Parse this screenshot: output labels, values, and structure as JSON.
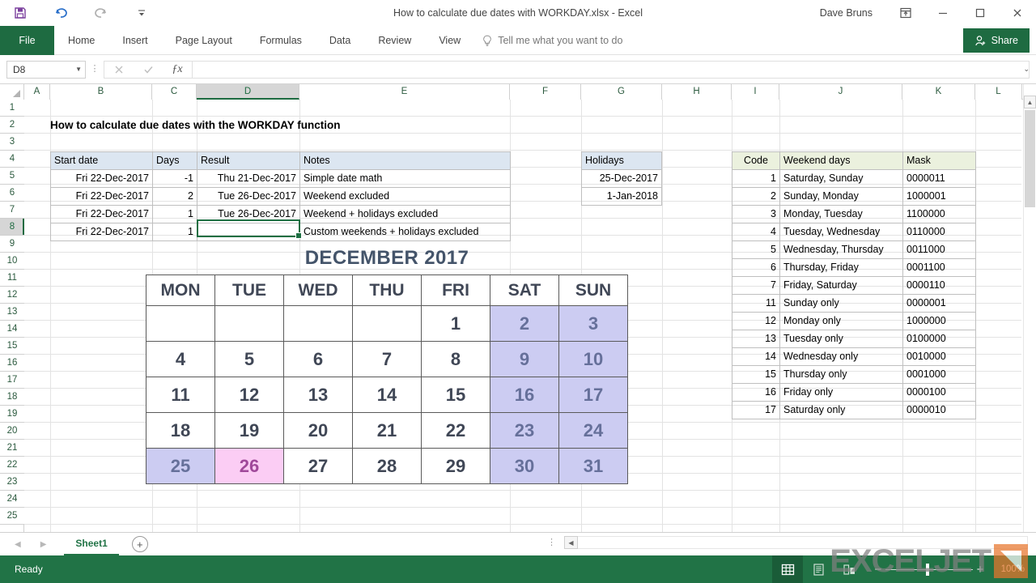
{
  "titlebar": {
    "save_icon": "save-icon",
    "undo_icon": "undo-icon",
    "redo_icon": "redo-icon",
    "customize_icon": "customize-qat-icon",
    "document_title": "How to calculate due dates with WORKDAY.xlsx - Excel",
    "username": "Dave Bruns",
    "ribbon_display_icon": "ribbon-display-options-icon",
    "minimize": "—",
    "maximize": "☐",
    "close": "✕"
  },
  "ribbon": {
    "file_tab": "File",
    "tabs": [
      "Home",
      "Insert",
      "Page Layout",
      "Formulas",
      "Data",
      "Review",
      "View"
    ],
    "tell_me": "Tell me what you want to do",
    "share": "Share"
  },
  "formula_bar": {
    "name_box": "D8",
    "cancel_icon": "cancel-icon",
    "enter_icon": "confirm-icon",
    "function_icon": "insert-function-icon",
    "formula_value": "",
    "expand_icon": "expand-formula-bar-icon"
  },
  "grid": {
    "columns": [
      "A",
      "B",
      "C",
      "D",
      "E",
      "F",
      "G",
      "H",
      "I",
      "J",
      "K",
      "L"
    ],
    "selected_column": "D",
    "rows": [
      1,
      2,
      3,
      4,
      5,
      6,
      7,
      8,
      9,
      10,
      11,
      12,
      13,
      14,
      15,
      16,
      17,
      18,
      19,
      20,
      21,
      22,
      23,
      24,
      25
    ],
    "selected_row": 8,
    "selected_cell": "D8"
  },
  "sheet": {
    "title": "How to calculate due dates with the WORKDAY function",
    "main_table": {
      "headers": [
        "Start date",
        "Days",
        "Result",
        "Notes"
      ],
      "rows": [
        {
          "start_date": "Fri 22-Dec-2017",
          "days": "-1",
          "result": "Thu 21-Dec-2017",
          "notes": "Simple date math"
        },
        {
          "start_date": "Fri 22-Dec-2017",
          "days": "2",
          "result": "Tue 26-Dec-2017",
          "notes": "Weekend excluded"
        },
        {
          "start_date": "Fri 22-Dec-2017",
          "days": "1",
          "result": "Tue 26-Dec-2017",
          "notes": "Weekend + holidays excluded"
        },
        {
          "start_date": "Fri 22-Dec-2017",
          "days": "1",
          "result": "",
          "notes": "Custom weekends + holidays excluded"
        }
      ]
    },
    "holidays_table": {
      "header": "Holidays",
      "rows": [
        "25-Dec-2017",
        "1-Jan-2018"
      ]
    },
    "weekend_codes_table": {
      "headers": [
        "Code",
        "Weekend days",
        "Mask"
      ],
      "rows": [
        {
          "code": "1",
          "days": "Saturday, Sunday",
          "mask": "0000011"
        },
        {
          "code": "2",
          "days": "Sunday, Monday",
          "mask": "1000001"
        },
        {
          "code": "3",
          "days": "Monday, Tuesday",
          "mask": "1100000"
        },
        {
          "code": "4",
          "days": "Tuesday, Wednesday",
          "mask": "0110000"
        },
        {
          "code": "5",
          "days": "Wednesday, Thursday",
          "mask": "0011000"
        },
        {
          "code": "6",
          "days": "Thursday, Friday",
          "mask": "0001100"
        },
        {
          "code": "7",
          "days": "Friday, Saturday",
          "mask": "0000110"
        },
        {
          "code": "11",
          "days": "Sunday only",
          "mask": "0000001"
        },
        {
          "code": "12",
          "days": "Monday only",
          "mask": "1000000"
        },
        {
          "code": "13",
          "days": "Tuesday only",
          "mask": "0100000"
        },
        {
          "code": "14",
          "days": "Wednesday only",
          "mask": "0010000"
        },
        {
          "code": "15",
          "days": "Thursday only",
          "mask": "0001000"
        },
        {
          "code": "16",
          "days": "Friday only",
          "mask": "0000100"
        },
        {
          "code": "17",
          "days": "Saturday only",
          "mask": "0000010"
        }
      ]
    },
    "calendar": {
      "title": "DECEMBER 2017",
      "day_headers": [
        "MON",
        "TUE",
        "WED",
        "THU",
        "FRI",
        "SAT",
        "SUN"
      ],
      "weeks": [
        [
          {
            "d": "",
            "t": "empty"
          },
          {
            "d": "",
            "t": "empty"
          },
          {
            "d": "",
            "t": "empty"
          },
          {
            "d": "",
            "t": "empty"
          },
          {
            "d": "1",
            "t": "day"
          },
          {
            "d": "2",
            "t": "weekend"
          },
          {
            "d": "3",
            "t": "weekend"
          }
        ],
        [
          {
            "d": "4",
            "t": "day"
          },
          {
            "d": "5",
            "t": "day"
          },
          {
            "d": "6",
            "t": "day"
          },
          {
            "d": "7",
            "t": "day"
          },
          {
            "d": "8",
            "t": "day"
          },
          {
            "d": "9",
            "t": "weekend"
          },
          {
            "d": "10",
            "t": "weekend"
          }
        ],
        [
          {
            "d": "11",
            "t": "day"
          },
          {
            "d": "12",
            "t": "day"
          },
          {
            "d": "13",
            "t": "day"
          },
          {
            "d": "14",
            "t": "day"
          },
          {
            "d": "15",
            "t": "day"
          },
          {
            "d": "16",
            "t": "weekend"
          },
          {
            "d": "17",
            "t": "weekend"
          }
        ],
        [
          {
            "d": "18",
            "t": "day"
          },
          {
            "d": "19",
            "t": "day"
          },
          {
            "d": "20",
            "t": "day"
          },
          {
            "d": "21",
            "t": "day"
          },
          {
            "d": "22",
            "t": "day"
          },
          {
            "d": "23",
            "t": "weekend"
          },
          {
            "d": "24",
            "t": "weekend"
          }
        ],
        [
          {
            "d": "25",
            "t": "weekend"
          },
          {
            "d": "26",
            "t": "highlight"
          },
          {
            "d": "27",
            "t": "day"
          },
          {
            "d": "28",
            "t": "day"
          },
          {
            "d": "29",
            "t": "day"
          },
          {
            "d": "30",
            "t": "weekend"
          },
          {
            "d": "31",
            "t": "weekend"
          }
        ]
      ],
      "colors": {
        "weekend_bg": "#ccccf2",
        "weekend_fg": "#66709a",
        "highlight_bg": "#fbcdf4",
        "highlight_fg": "#a0499a",
        "title_fg": "#44546a"
      }
    }
  },
  "sheet_tabs": {
    "prev_icon": "prev-sheet-icon",
    "next_icon": "next-sheet-icon",
    "tabs": [
      "Sheet1"
    ],
    "active_tab": "Sheet1",
    "add_sheet": "+"
  },
  "status_bar": {
    "status_text": "Ready",
    "normal_view_icon": "normal-view-icon",
    "page_layout_icon": "page-layout-view-icon",
    "page_break_icon": "page-break-preview-icon",
    "zoom_out": "−",
    "zoom_in": "+",
    "zoom_level": "100%"
  },
  "watermark": {
    "text": "EXCELJET",
    "logo": "exceljet-logo-icon"
  },
  "theme": {
    "excel_green": "#217346",
    "file_tab_green": "#1e6b41",
    "header_blue": "#dce6f1",
    "header_green": "#ebf1de",
    "selection_green": "#1d6f42"
  }
}
